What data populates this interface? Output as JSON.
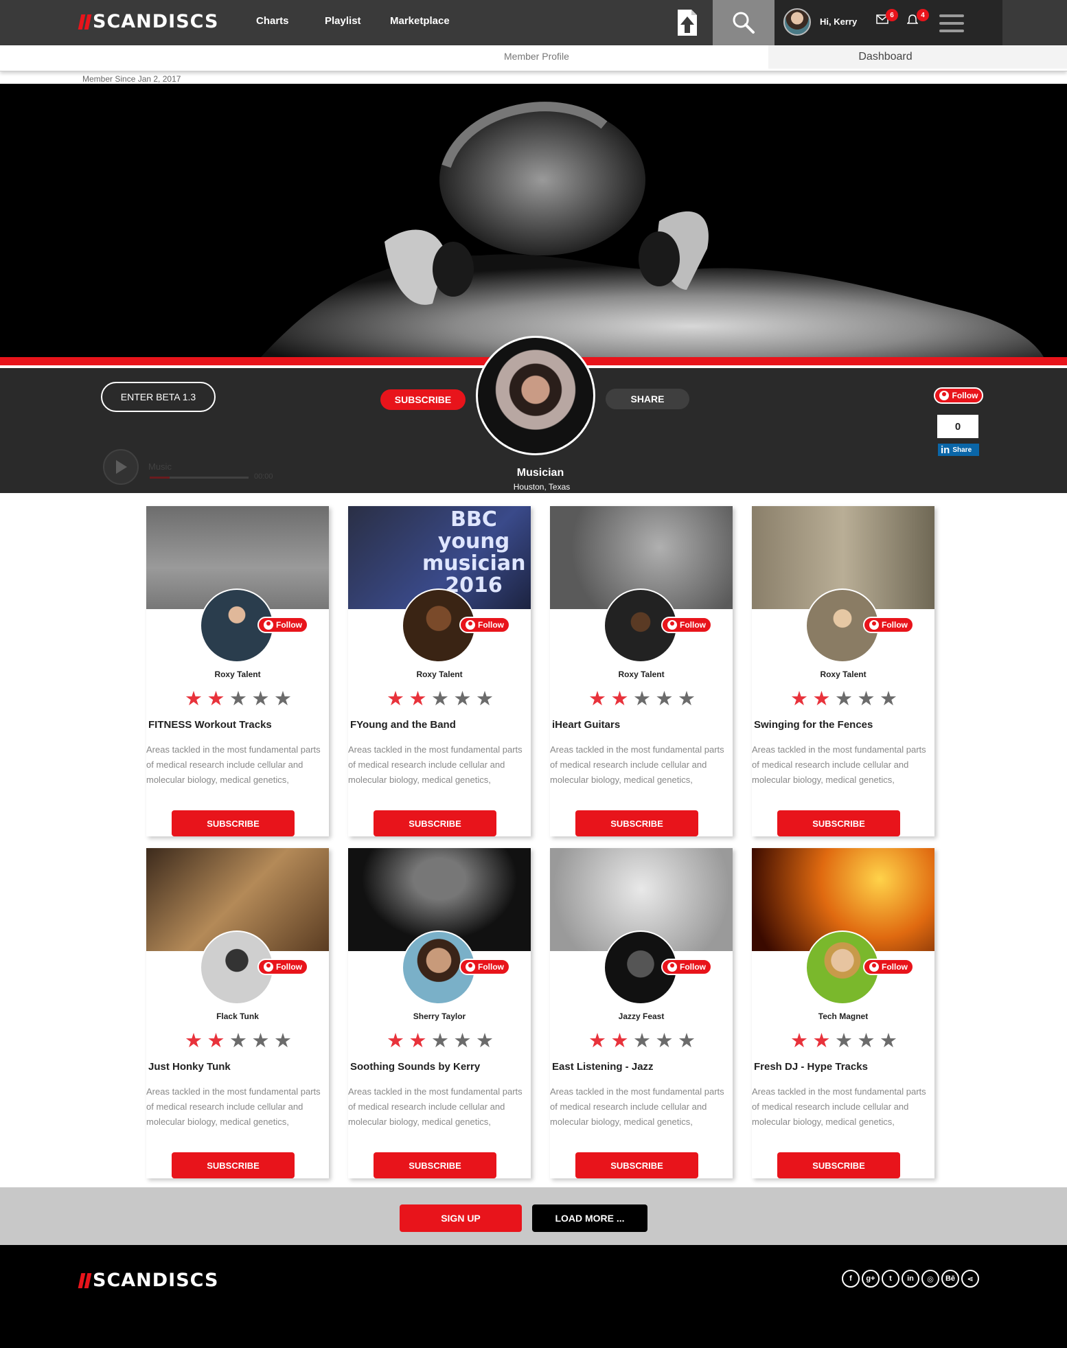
{
  "brand": {
    "name": "SCANDISCS"
  },
  "nav": {
    "links": [
      "Charts",
      "Playlist",
      "Marketplace"
    ]
  },
  "user": {
    "greeting": "Hi, Kerry",
    "messages_count": "6",
    "notifications_count": "4"
  },
  "tabs": {
    "member_profile": "Member Profile",
    "dashboard": "Dashboard"
  },
  "member_since": "Member Since Jan 2, 2017",
  "profile": {
    "beta_label": "ENTER BETA 1.3",
    "subscribe_label": "SUBSCRIBE",
    "share_label": "SHARE",
    "name": "Musician",
    "location": "Houston, Texas",
    "follow_label": "Follow",
    "follow_count": "0",
    "linkedin_share": "Share",
    "player": {
      "label": "Music",
      "time": "00:00",
      "progress": 0.2
    }
  },
  "colors": {
    "accent": "#e8141b",
    "star_on": "#e8323b",
    "star_off": "#6b6b6b"
  },
  "cards": [
    {
      "artist": "Roxy Talent",
      "title": "FITNESS Workout Tracks",
      "rating": 2,
      "follow": "Follow",
      "subscribe": "SUBSCRIBE",
      "desc": "Areas tackled in the most fundamental parts of medical research include cellular and molecular biology, medical genetics,"
    },
    {
      "artist": "Roxy Talent",
      "title": "FYoung and the Band",
      "rating": 2,
      "follow": "Follow",
      "subscribe": "SUBSCRIBE",
      "desc": "Areas tackled in the most fundamental parts of medical research include cellular and molecular biology, medical genetics,",
      "image_text": [
        "BBC",
        "young",
        "musician",
        "2016"
      ]
    },
    {
      "artist": "Roxy Talent",
      "title": "iHeart Guitars",
      "rating": 2,
      "follow": "Follow",
      "subscribe": "SUBSCRIBE",
      "desc": "Areas tackled in the most fundamental parts of medical research include cellular and molecular biology, medical genetics,"
    },
    {
      "artist": "Roxy Talent",
      "title": "Swinging for the Fences",
      "rating": 2,
      "follow": "Follow",
      "subscribe": "SUBSCRIBE",
      "desc": "Areas tackled in the most fundamental parts of medical research include cellular and molecular biology, medical genetics,"
    },
    {
      "artist": "Flack Tunk",
      "title": "Just Honky Tunk",
      "rating": 2,
      "follow": "Follow",
      "subscribe": "SUBSCRIBE",
      "desc": "Areas tackled in the most fundamental parts of medical research include cellular and molecular biology, medical genetics,"
    },
    {
      "artist": "Sherry Taylor",
      "title": "Soothing Sounds by Kerry",
      "rating": 2,
      "follow": "Follow",
      "subscribe": "SUBSCRIBE",
      "desc": "Areas tackled in the most fundamental parts of medical research include cellular and molecular biology, medical genetics,"
    },
    {
      "artist": "Jazzy Feast",
      "title": "East Listening - Jazz",
      "rating": 2,
      "follow": "Follow",
      "subscribe": "SUBSCRIBE",
      "desc": "Areas tackled in the most fundamental parts of medical research include cellular and molecular biology, medical genetics,"
    },
    {
      "artist": "Tech Magnet",
      "title": "Fresh DJ - Hype Tracks",
      "rating": 2,
      "follow": "Follow",
      "subscribe": "SUBSCRIBE",
      "desc": "Areas tackled in the most fundamental parts of medical research include cellular and molecular biology, medical genetics,"
    }
  ],
  "actions": {
    "signup": "SIGN UP",
    "load_more": "LOAD MORE ..."
  },
  "footer": {
    "social_icons": [
      "facebook-icon",
      "google-plus-icon",
      "twitter-icon",
      "linkedin-icon",
      "instagram-icon",
      "behance-icon",
      "share-icon"
    ]
  }
}
